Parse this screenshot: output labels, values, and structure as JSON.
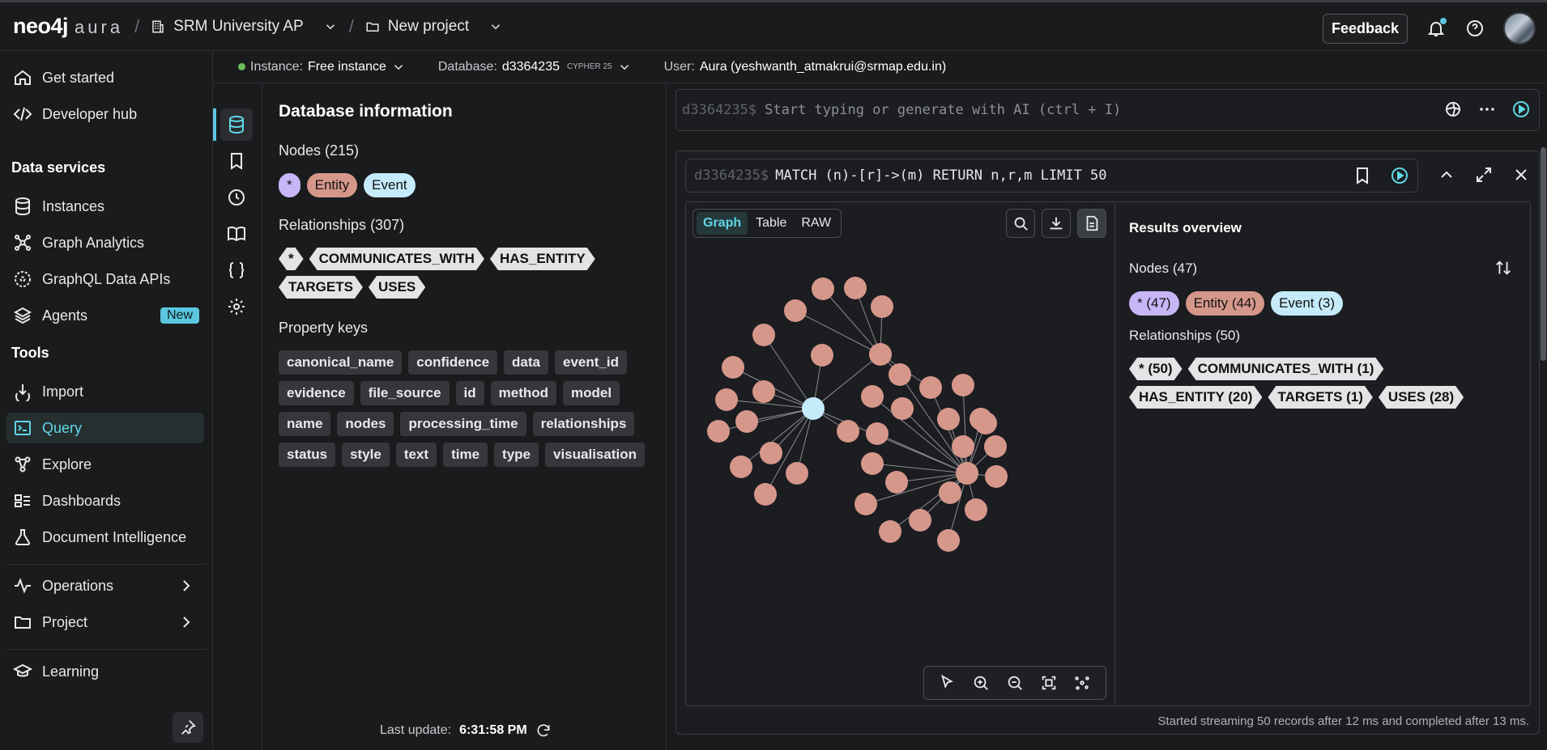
{
  "brand": {
    "name": "neo4j",
    "product": "aura"
  },
  "breadcrumb": {
    "org": "SRM University AP",
    "project": "New project"
  },
  "topbar": {
    "feedback": "Feedback"
  },
  "sidebar": {
    "get_started": "Get started",
    "developer_hub": "Developer hub",
    "data_services_heading": "Data services",
    "instances": "Instances",
    "graph_analytics": "Graph Analytics",
    "graphql": "GraphQL Data APIs",
    "agents": "Agents",
    "agents_badge": "New",
    "tools_heading": "Tools",
    "import": "Import",
    "query": "Query",
    "explore": "Explore",
    "dashboards": "Dashboards",
    "document_intelligence": "Document Intelligence",
    "operations": "Operations",
    "project": "Project",
    "learning": "Learning"
  },
  "infobar": {
    "instance_label": "Instance:",
    "instance_value": "Free instance",
    "database_label": "Database:",
    "database_value": "d3364235",
    "cypher_tag": "CYPHER 25",
    "user_label": "User:",
    "user_value": "Aura (yeshwanth_atmakrui@srmap.edu.in)"
  },
  "dbinfo": {
    "title": "Database information",
    "nodes_heading": "Nodes (215)",
    "node_labels": [
      "*",
      "Entity",
      "Event"
    ],
    "relationships_heading": "Relationships (307)",
    "rel_types": [
      "*",
      "COMMUNICATES_WITH",
      "HAS_ENTITY",
      "TARGETS",
      "USES"
    ],
    "property_keys_heading": "Property keys",
    "property_keys": [
      "canonical_name",
      "confidence",
      "data",
      "event_id",
      "evidence",
      "file_source",
      "id",
      "method",
      "model",
      "name",
      "nodes",
      "processing_time",
      "relationships",
      "status",
      "style",
      "text",
      "time",
      "type",
      "visualisation"
    ],
    "last_update_label": "Last update:",
    "last_update_value": "6:31:58 PM"
  },
  "editor": {
    "prompt": "d3364235$",
    "placeholder": "Start typing or generate with AI (ctrl + I)"
  },
  "result_card": {
    "prompt": "d3364235$",
    "query": "MATCH (n)-[r]->(m) RETURN n,r,m LIMIT 50",
    "tabs": [
      "Graph",
      "Table",
      "RAW"
    ],
    "active_tab": "Graph",
    "overview_title": "Results overview",
    "overview_nodes": "Nodes (47)",
    "overview_node_labels": [
      "* (47)",
      "Entity (44)",
      "Event (3)"
    ],
    "overview_relationships": "Relationships (50)",
    "overview_rel_types": [
      "* (50)",
      "COMMUNICATES_WITH (1)",
      "HAS_ENTITY (20)",
      "TARGETS (1)",
      "USES (28)"
    ],
    "status": "Started streaming 50 records after 12 ms and completed after 13 ms."
  },
  "colors": {
    "accent": "#5cc8e0",
    "entity": "#d6978b",
    "event": "#c5ebfb",
    "star": "#c7b6f7",
    "edge": "#8a8d92"
  }
}
